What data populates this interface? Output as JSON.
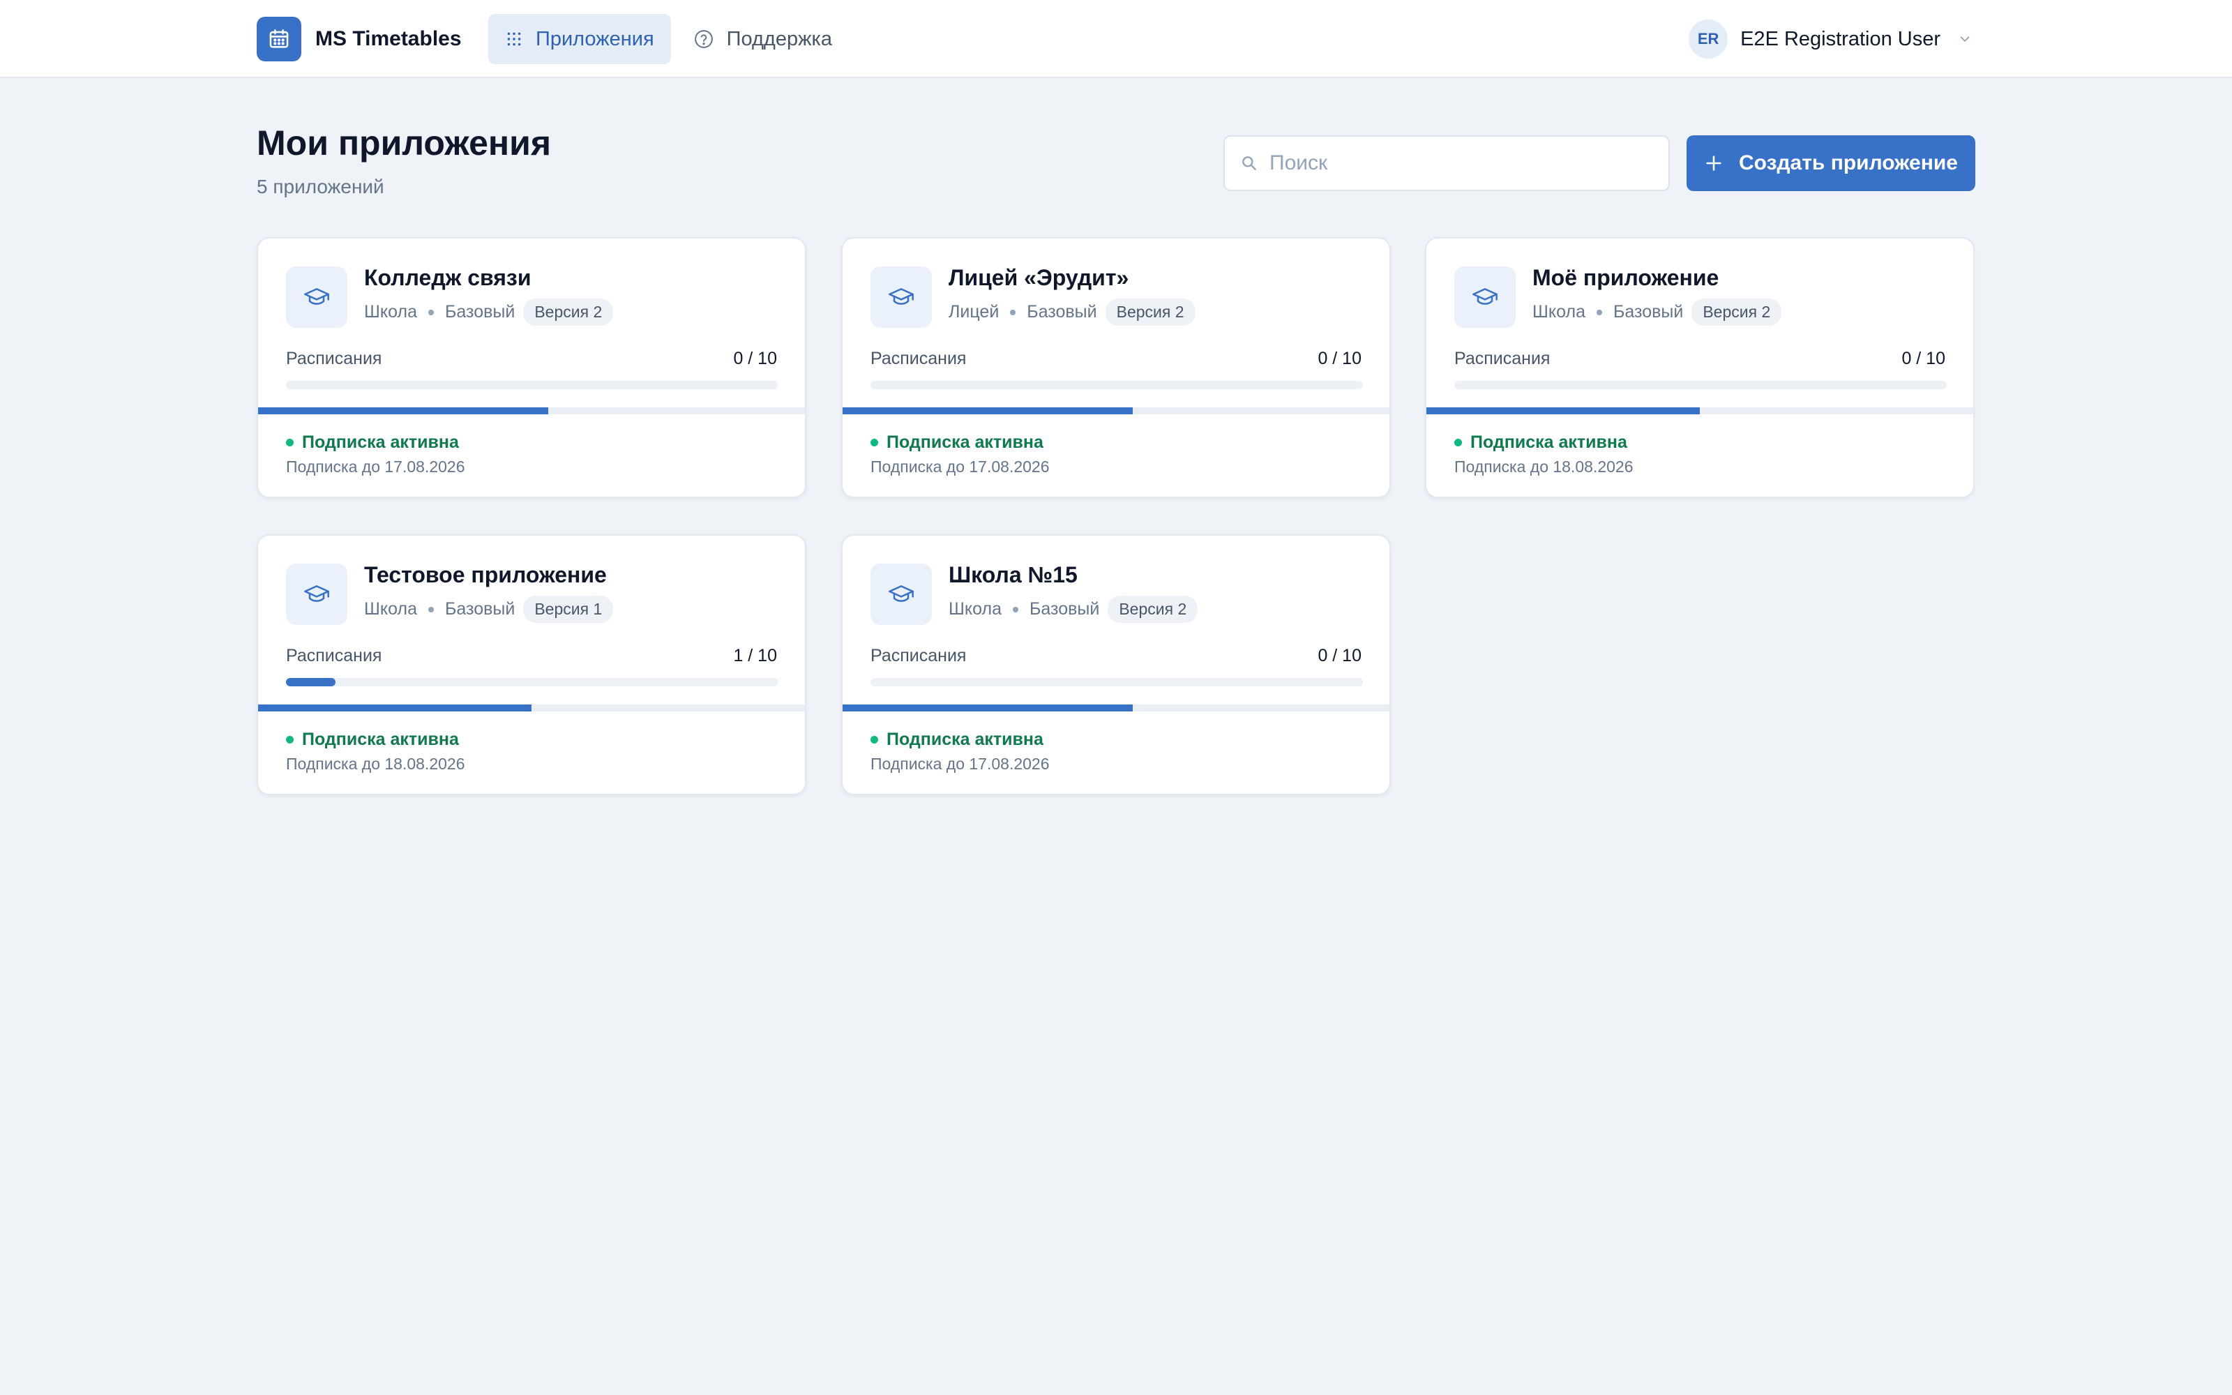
{
  "app": {
    "name": "MS Timetables"
  },
  "nav": [
    {
      "label": "Приложения",
      "icon": "grid-icon",
      "active": true
    },
    {
      "label": "Поддержка",
      "icon": "help-circle-icon",
      "active": false
    }
  ],
  "user": {
    "initials": "ER",
    "name": "E2E Registration User"
  },
  "page": {
    "title": "Мои приложения",
    "subtitle": "5 приложений",
    "search_placeholder": "Поиск",
    "create_label": "Создать приложение"
  },
  "colors": {
    "accent": "#3771c8",
    "background": "#eff3f8",
    "status_active": "#10b981"
  },
  "cards": [
    {
      "title": "Колледж связи",
      "type": "Школа",
      "plan": "Базовый",
      "version": "Версия 2",
      "schedules_label": "Расписания",
      "schedules": "0 / 10",
      "schedules_used": 0,
      "schedules_max": 10,
      "subscription_progress": 0.53,
      "status": "Подписка активна",
      "until": "Подписка до 17.08.2026"
    },
    {
      "title": "Лицей «Эрудит»",
      "type": "Лицей",
      "plan": "Базовый",
      "version": "Версия 2",
      "schedules_label": "Расписания",
      "schedules": "0 / 10",
      "schedules_used": 0,
      "schedules_max": 10,
      "subscription_progress": 0.53,
      "status": "Подписка активна",
      "until": "Подписка до 17.08.2026"
    },
    {
      "title": "Моё приложение",
      "type": "Школа",
      "plan": "Базовый",
      "version": "Версия 2",
      "schedules_label": "Расписания",
      "schedules": "0 / 10",
      "schedules_used": 0,
      "schedules_max": 10,
      "subscription_progress": 0.5,
      "status": "Подписка активна",
      "until": "Подписка до 18.08.2026"
    },
    {
      "title": "Тестовое приложение",
      "type": "Школа",
      "plan": "Базовый",
      "version": "Версия 1",
      "schedules_label": "Расписания",
      "schedules": "1 / 10",
      "schedules_used": 1,
      "schedules_max": 10,
      "subscription_progress": 0.5,
      "status": "Подписка активна",
      "until": "Подписка до 18.08.2026"
    },
    {
      "title": "Школа №15",
      "type": "Школа",
      "plan": "Базовый",
      "version": "Версия 2",
      "schedules_label": "Расписания",
      "schedules": "0 / 10",
      "schedules_used": 0,
      "schedules_max": 10,
      "subscription_progress": 0.53,
      "status": "Подписка активна",
      "until": "Подписка до 17.08.2026"
    }
  ]
}
